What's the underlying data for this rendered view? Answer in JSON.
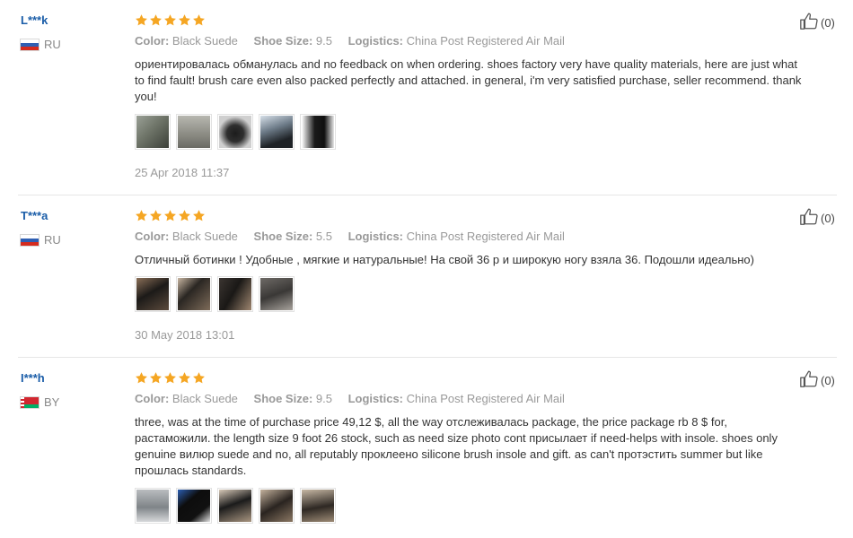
{
  "reviews": [
    {
      "user": "L***k",
      "country": "RU",
      "color_label": "Color:",
      "color": "Black Suede",
      "size_label": "Shoe Size:",
      "size": "9.5",
      "logistics_label": "Logistics:",
      "logistics": "China Post Registered Air Mail",
      "text": "ориентировалась обманулась and no feedback on when ordering. shoes factory very have quality materials, here are just what to find fault! brush care even also packed perfectly and attached. in general, i'm very satisfied purchase, seller recommend. thank you!",
      "date": "25 Apr 2018 11:37",
      "likes": "(0)",
      "rating": 5,
      "photo_count": 5
    },
    {
      "user": "T***a",
      "country": "RU",
      "color_label": "Color:",
      "color": "Black Suede",
      "size_label": "Shoe Size:",
      "size": "5.5",
      "logistics_label": "Logistics:",
      "logistics": "China Post Registered Air Mail",
      "text": "Отличный ботинки ! Удобные , мягкие и натуральные! На свой 36 р и широкую ногу взяла 36. Подошли идеально)",
      "date": "30 May 2018 13:01",
      "likes": "(0)",
      "rating": 5,
      "photo_count": 4
    },
    {
      "user": "I***h",
      "country": "BY",
      "color_label": "Color:",
      "color": "Black Suede",
      "size_label": "Shoe Size:",
      "size": "9.5",
      "logistics_label": "Logistics:",
      "logistics": "China Post Registered Air Mail",
      "text": "three, was at the time of purchase price 49,12 $, all the way отслеживалась package, the price package rb 8 $ for, растаможили. the length size 9 foot 26 stock, such as need size photo cont присылает if need-helps with insole. shoes only genuine вилюр suede and no, all reputably проклеено silicone brush insole and gift. as can't протэстить summer but like прошлась standards.",
      "likes": "(0)",
      "rating": 5,
      "photo_count": 5
    }
  ],
  "colors": {
    "username": "#1a5da8",
    "star": "#f5a623",
    "muted": "#999999"
  },
  "icons": {
    "star": "star-icon",
    "like": "thumbs-up-icon",
    "flag_ru": "russia-flag-icon",
    "flag_by": "belarus-flag-icon"
  }
}
